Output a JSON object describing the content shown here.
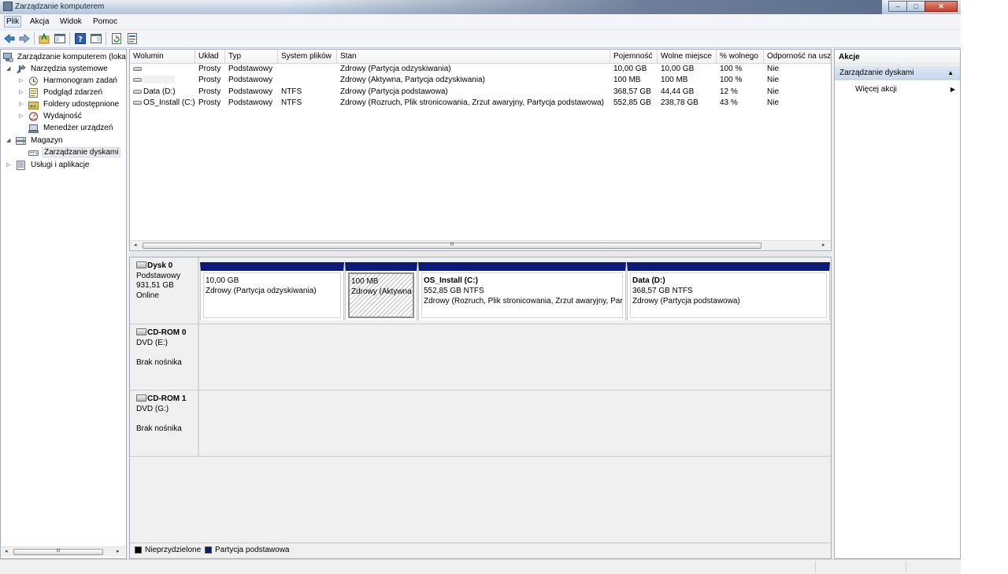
{
  "window": {
    "title": "Zarządzanie komputerem",
    "controls": [
      "–",
      "□",
      "✕"
    ]
  },
  "menu": [
    "Plik",
    "Akcja",
    "Widok",
    "Pomoc"
  ],
  "tree": [
    {
      "label": "Zarządzanie komputerem (loka",
      "level": 0,
      "arrow": "",
      "icon": "computer-management-icon"
    },
    {
      "label": "Narzędzia systemowe",
      "level": 1,
      "arrow": "◢",
      "icon": "tools-icon"
    },
    {
      "label": "Harmonogram zadań",
      "level": 2,
      "arrow": "▷",
      "icon": "clock-icon"
    },
    {
      "label": "Podgląd zdarzeń",
      "level": 2,
      "arrow": "▷",
      "icon": "event-viewer-icon"
    },
    {
      "label": "Foldery udostępnione",
      "level": 2,
      "arrow": "▷",
      "icon": "shared-folder-icon"
    },
    {
      "label": "Wydajność",
      "level": 2,
      "arrow": "▷",
      "icon": "performance-icon"
    },
    {
      "label": "Menedżer urządzeń",
      "level": 2,
      "arrow": "",
      "icon": "device-manager-icon"
    },
    {
      "label": "Magazyn",
      "level": 1,
      "arrow": "◢",
      "icon": "storage-icon"
    },
    {
      "label": "Zarządzanie dyskami",
      "level": 2,
      "arrow": "",
      "icon": "disk-management-icon",
      "selected": true
    },
    {
      "label": "Usługi i aplikacje",
      "level": 1,
      "arrow": "▷",
      "icon": "services-icon"
    }
  ],
  "volumes": {
    "columns": [
      "Wolumin",
      "Układ",
      "Typ",
      "System plików",
      "Stan",
      "Pojemność",
      "Wolne miejsce",
      "% wolnego",
      "Odporność na usz"
    ],
    "rows": [
      [
        "",
        "Prosty",
        "Podstawowy",
        "",
        "Zdrowy (Partycja odzyskiwania)",
        "10,00 GB",
        "10,00 GB",
        "100 %",
        "Nie"
      ],
      [
        "",
        "Prosty",
        "Podstawowy",
        "",
        "Zdrowy (Aktywna, Partycja odzyskiwania)",
        "100 MB",
        "100 MB",
        "100 %",
        "Nie"
      ],
      [
        "Data (D:)",
        "Prosty",
        "Podstawowy",
        "NTFS",
        "Zdrowy (Partycja podstawowa)",
        "368,57 GB",
        "44,44 GB",
        "12 %",
        "Nie"
      ],
      [
        "OS_Install (C:)",
        "Prosty",
        "Podstawowy",
        "NTFS",
        "Zdrowy (Rozruch, Plik stronicowania, Zrzut awaryjny, Partycja podstawowa)",
        "552,85 GB",
        "238,78 GB",
        "43 %",
        "Nie"
      ]
    ],
    "scroll_grip": "III"
  },
  "disks": [
    {
      "title": "Dysk 0",
      "lines": [
        "Podstawowy",
        "931,51 GB",
        "Online"
      ],
      "partitions": [
        {
          "name": "",
          "size": "10,00 GB",
          "status": "Zdrowy (Partycja odzyskiwania)",
          "hatched": false
        },
        {
          "name": "",
          "size": "100 MB",
          "status": "Zdrowy (Aktywna",
          "hatched": true
        },
        {
          "name": "OS_Install  (C:)",
          "size": "552,85 GB NTFS",
          "status": "Zdrowy (Rozruch, Plik stronicowania, Zrzut awaryjny, Par",
          "hatched": false
        },
        {
          "name": "Data  (D:)",
          "size": "368,57 GB NTFS",
          "status": "Zdrowy (Partycja podstawowa)",
          "hatched": false
        }
      ]
    },
    {
      "title": "CD-ROM 0",
      "lines": [
        "DVD (E:)",
        "",
        "Brak nośnika"
      ],
      "partitions": []
    },
    {
      "title": "CD-ROM 1",
      "lines": [
        "DVD (G:)",
        "",
        "Brak nośnika"
      ],
      "partitions": []
    }
  ],
  "legend": [
    {
      "label": "Nieprzydzielone",
      "color": "#000000"
    },
    {
      "label": "Partycja podstawowa",
      "color": "#0a1b7c"
    }
  ],
  "actions": {
    "header": "Akcje",
    "section": "Zarządzanie dyskami",
    "section_arrow": "▲",
    "items": [
      {
        "label": "Więcej akcji",
        "arrow": "▶"
      }
    ]
  },
  "left_scroll_grip": "III"
}
